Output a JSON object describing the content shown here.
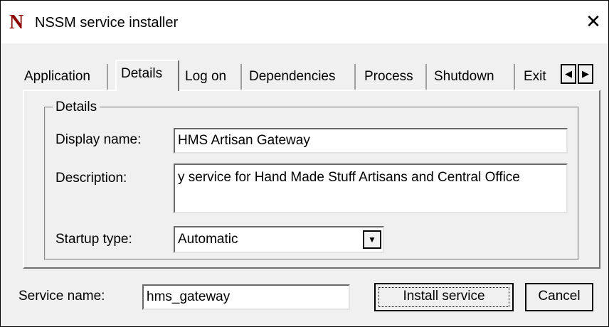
{
  "window": {
    "title": "NSSM service installer",
    "app_icon": "N"
  },
  "tabs": [
    {
      "label": "Application",
      "active": false
    },
    {
      "label": "Details",
      "active": true
    },
    {
      "label": "Log on",
      "active": false
    },
    {
      "label": "Dependencies",
      "active": false
    },
    {
      "label": "Process",
      "active": false
    },
    {
      "label": "Shutdown",
      "active": false
    },
    {
      "label": "Exit",
      "active": false
    }
  ],
  "details": {
    "group_label": "Details",
    "display_name_label": "Display name:",
    "display_name_value": "HMS Artisan Gateway",
    "description_label": "Description:",
    "description_value": "y service for Hand Made Stuff Artisans and Central Office",
    "startup_type_label": "Startup type:",
    "startup_type_value": "Automatic"
  },
  "footer": {
    "service_name_label": "Service name:",
    "service_name_value": "hms_gateway",
    "install_label": "Install service",
    "cancel_label": "Cancel"
  }
}
